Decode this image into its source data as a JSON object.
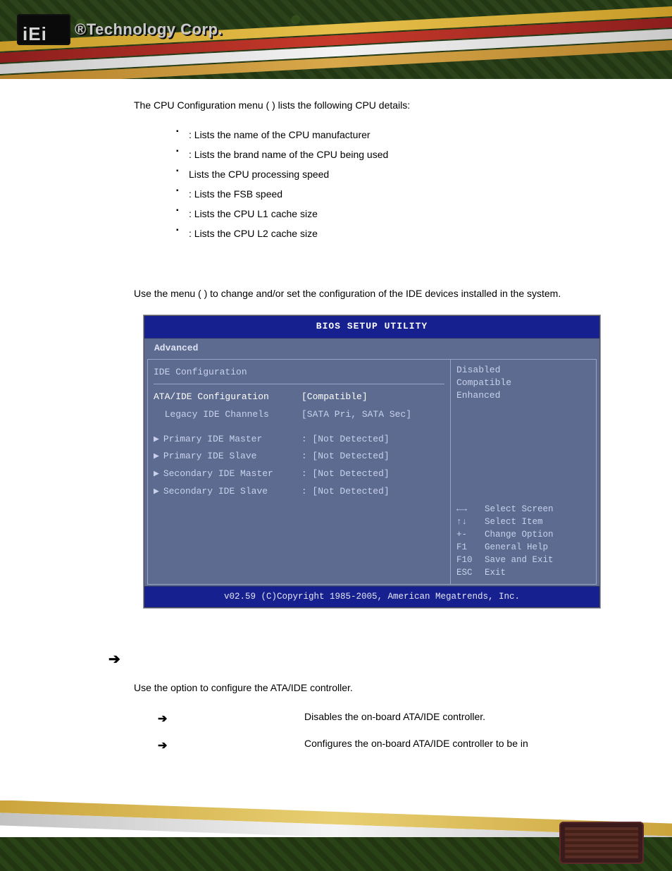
{
  "brand": {
    "reg": "®",
    "name": "Technology Corp."
  },
  "intro": {
    "pre": "The CPU Configuration menu (",
    "post": ") lists the following CPU details:"
  },
  "bullets": [
    ": Lists the name of the CPU manufacturer",
    ": Lists the brand name of the CPU being used",
    "Lists the CPU processing speed",
    ": Lists the FSB speed",
    ": Lists the CPU L1 cache size",
    ": Lists the CPU L2 cache size"
  ],
  "para2": {
    "a": "Use the ",
    "b": " menu (",
    "c": ") to change and/or set the configuration of the IDE devices installed in the system."
  },
  "bios": {
    "title": "BIOS SETUP UTILITY",
    "tab": "Advanced",
    "heading": "IDE Configuration",
    "rows": [
      {
        "label": "ATA/IDE Configuration",
        "value": "[Compatible]",
        "selected": true
      },
      {
        "label": "  Legacy IDE Channels",
        "value": "[SATA Pri, SATA Sec]",
        "selected": false
      }
    ],
    "devrows": [
      {
        "label": "Primary IDE Master",
        "value": ": [Not Detected]"
      },
      {
        "label": "Primary IDE Slave",
        "value": ": [Not Detected]"
      },
      {
        "label": "Secondary IDE Master",
        "value": ": [Not Detected]"
      },
      {
        "label": "Secondary IDE Slave",
        "value": ": [Not Detected]"
      }
    ],
    "options": [
      "Disabled",
      "Compatible",
      "Enhanced"
    ],
    "help": [
      {
        "k": "←→",
        "t": "Select Screen"
      },
      {
        "k": "↑↓",
        "t": "Select Item"
      },
      {
        "k": "+-",
        "t": "Change Option"
      },
      {
        "k": "F1",
        "t": "General Help"
      },
      {
        "k": "F10",
        "t": "Save and Exit"
      },
      {
        "k": "ESC",
        "t": "Exit"
      }
    ],
    "footer": "v02.59 (C)Copyright 1985-2005, American Megatrends, Inc."
  },
  "section": {
    "lead": "Use the ",
    "tail": " option to configure the ATA/IDE controller."
  },
  "opts": [
    "Disables the on-board ATA/IDE controller.",
    "Configures the on-board ATA/IDE controller to be in"
  ]
}
